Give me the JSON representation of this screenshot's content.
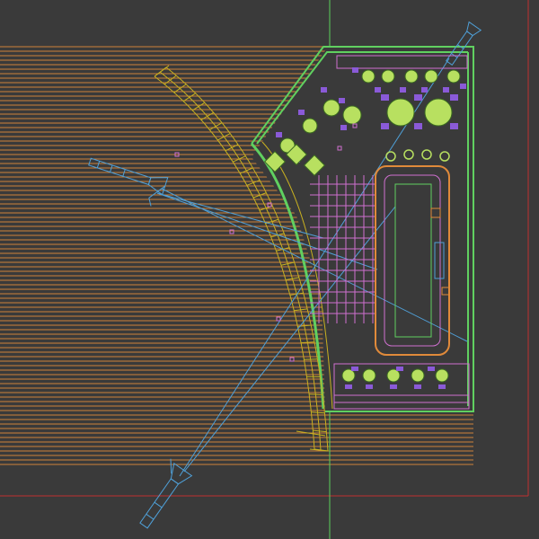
{
  "viewport": {
    "name": "cad-top-viewport",
    "background": "#3a3a3a"
  },
  "colors": {
    "deck_planks": "#e08a3a",
    "railing": "#c8b020",
    "interior_lines": "#d070d0",
    "walls": "#60d060",
    "light_beams": "#4fa0d8",
    "furniture_fill": "#b8e060",
    "chair_fill": "#8a5ad8",
    "limit_red": "#c03030",
    "axis_green": "#5ad05a"
  },
  "icons": {
    "spotlight": "spotlight-icon",
    "table": "round-table-icon",
    "chair": "chair-icon"
  }
}
